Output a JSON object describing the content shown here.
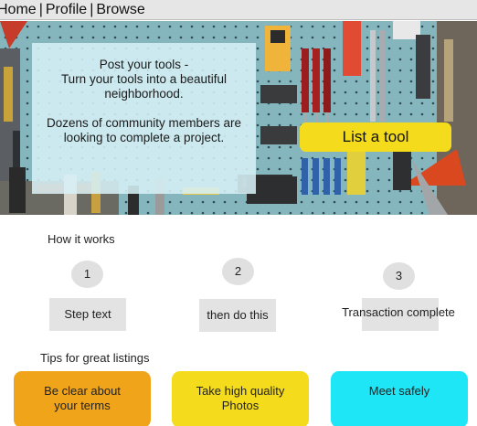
{
  "nav": {
    "home": "Home",
    "profile": "Profile",
    "browse": "Browse",
    "separator": "|"
  },
  "hero": {
    "heading": "Post your tools -",
    "line2": "Turn your tools into a beautiful neighborhood.",
    "line3": "Dozens of community members are looking to complete a project.",
    "cta_label": "List a tool",
    "cta_color": "#f4dc1d"
  },
  "how_it_works": {
    "title": "How it works",
    "steps": [
      {
        "number": "1",
        "text": "Step text"
      },
      {
        "number": "2",
        "text": "then do this"
      },
      {
        "number": "3",
        "text": "Transaction complete"
      }
    ]
  },
  "tips": {
    "title": "Tips for great listings",
    "cards": [
      {
        "text": "Be clear about your terms",
        "color": "#f0a41a"
      },
      {
        "text": "Take high quality Photos",
        "color": "#f4dc1d"
      },
      {
        "text": "Meet safely",
        "color": "#1fe6f6"
      }
    ]
  }
}
